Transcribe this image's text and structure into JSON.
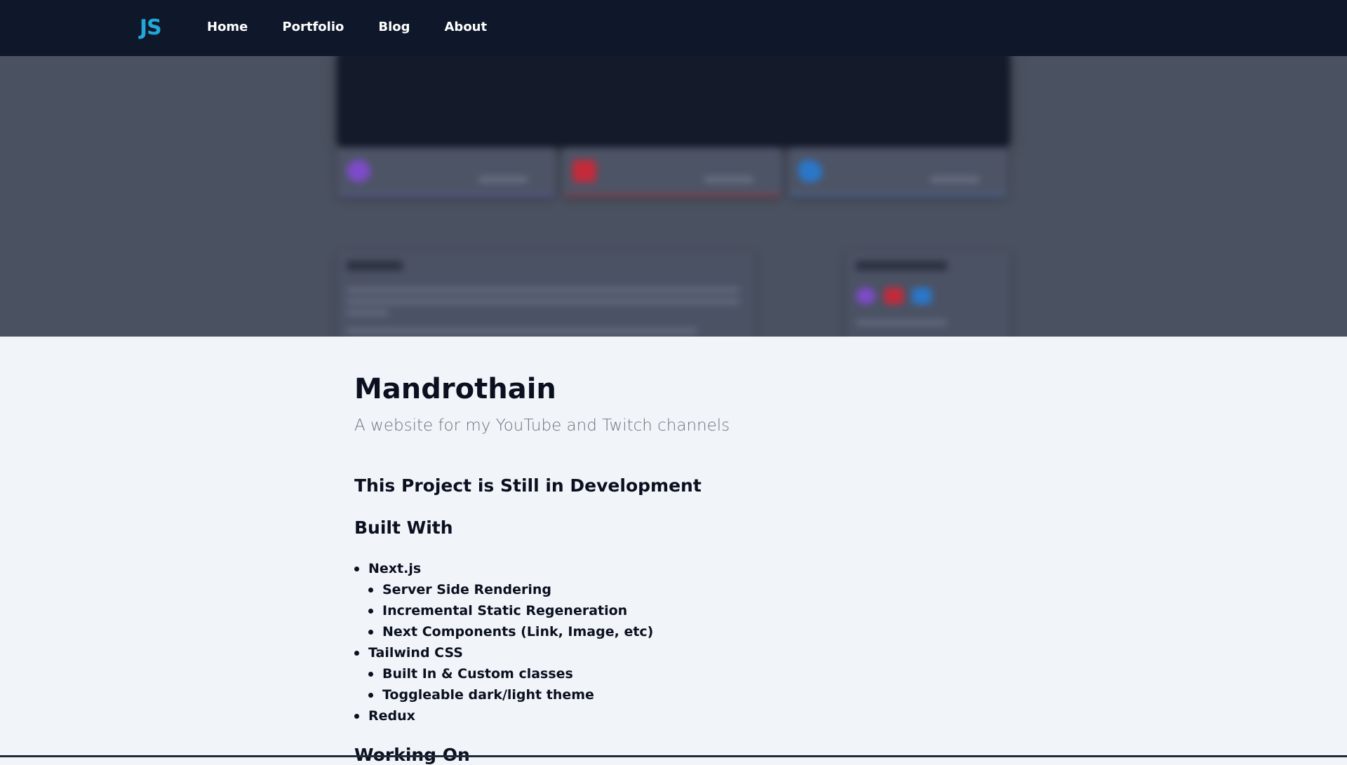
{
  "nav": {
    "logo": "JS",
    "links": [
      {
        "label": "Home"
      },
      {
        "label": "Portfolio"
      },
      {
        "label": "Blog"
      },
      {
        "label": "About"
      }
    ]
  },
  "project": {
    "title": "Mandrothain",
    "subtitle": "A website for my YouTube and Twitch channels",
    "status_heading": "This Project is Still in Development",
    "built_with_heading": "Built With",
    "built_with": [
      {
        "level": 1,
        "label": "Next.js"
      },
      {
        "level": 2,
        "label": "Server Side Rendering"
      },
      {
        "level": 2,
        "label": "Incremental Static Regeneration"
      },
      {
        "level": 2,
        "label": "Next Components (Link, Image, etc)"
      },
      {
        "level": 1,
        "label": "Tailwind CSS"
      },
      {
        "level": 2,
        "label": "Built In & Custom classes"
      },
      {
        "level": 2,
        "label": "Toggleable dark/light theme"
      },
      {
        "level": 1,
        "label": "Redux"
      }
    ],
    "working_on_heading": "Working On"
  },
  "colors": {
    "nav_bg": "#0f172a",
    "logo": "#22a7d6",
    "page_bg": "#f1f5f9"
  }
}
